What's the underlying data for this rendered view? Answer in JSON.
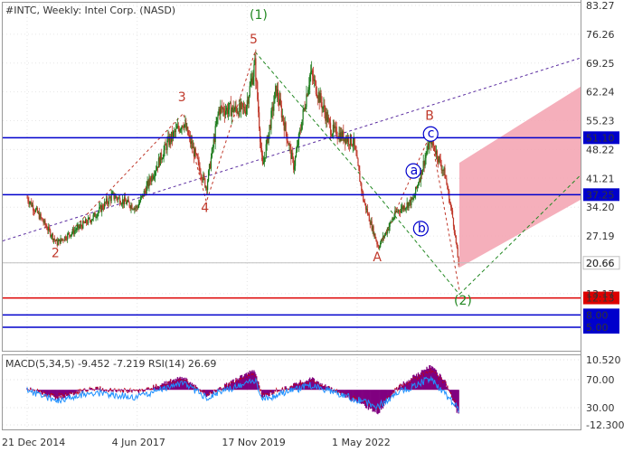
{
  "chart_data": [
    {
      "type": "candlestick",
      "title": "#INTC, Weekly:  Intel Corp. (NASD)",
      "y_ticks": [
        83.27,
        76.26,
        69.25,
        62.24,
        55.23,
        48.22,
        41.21,
        34.2,
        27.19,
        20.66,
        13.17,
        12.13,
        8.0,
        5.0
      ],
      "y_tick_labels": [
        "83.27",
        "76.26",
        "69.25",
        "62.24",
        "55.23",
        "48.22",
        "41.21",
        "34.20",
        "27.19",
        "20.66",
        "13.17"
      ],
      "x_tick_labels": [
        "21 Dec 2014",
        "4 Jun 2017",
        "17 Nov 2019",
        "1 May 2022"
      ],
      "price_path": [
        {
          "x": "2014-12-21",
          "y": 36.5
        },
        {
          "x": "2015-04-01",
          "y": 32.0
        },
        {
          "x": "2015-08-20",
          "y": 25.5
        },
        {
          "x": "2016-06-01",
          "y": 31.5
        },
        {
          "x": "2016-11-15",
          "y": 37.0
        },
        {
          "x": "2017-06-01",
          "y": 34.0
        },
        {
          "x": "2018-02-10",
          "y": 50.0
        },
        {
          "x": "2018-06-15",
          "y": 55.0
        },
        {
          "x": "2018-12-20",
          "y": 39.0
        },
        {
          "x": "2019-04-01",
          "y": 58.0
        },
        {
          "x": "2019-11-01",
          "y": 58.0
        },
        {
          "x": "2020-01-20",
          "y": 69.0
        },
        {
          "x": "2020-03-20",
          "y": 43.5
        },
        {
          "x": "2020-07-10",
          "y": 63.0
        },
        {
          "x": "2020-12-01",
          "y": 44.0
        },
        {
          "x": "2021-04-15",
          "y": 67.0
        },
        {
          "x": "2021-10-01",
          "y": 53.0
        },
        {
          "x": "2022-04-01",
          "y": 50.0
        },
        {
          "x": "2022-06-20",
          "y": 36.0
        },
        {
          "x": "2022-10-20",
          "y": 24.5
        },
        {
          "x": "2023-03-15",
          "y": 33.0
        },
        {
          "x": "2023-08-01",
          "y": 36.0
        },
        {
          "x": "2023-12-20",
          "y": 51.0
        },
        {
          "x": "2024-04-15",
          "y": 42.0
        },
        {
          "x": "2024-06-20",
          "y": 31.0
        },
        {
          "x": "2024-08-10",
          "y": 19.0
        }
      ],
      "horizontal_levels": [
        {
          "value": 51.1,
          "label": "51.10",
          "color": "#0000cc"
        },
        {
          "value": 37.25,
          "label": "37.25",
          "color": "#0000cc"
        },
        {
          "value": 20.66,
          "label": "20.66",
          "color": "#c0c0c0"
        },
        {
          "value": 12.13,
          "label": "12.13",
          "color": "#dd0000"
        },
        {
          "value": 8.0,
          "label": "8.00",
          "color": "#0000cc"
        },
        {
          "value": 5.0,
          "label": "5.00",
          "color": "#0000cc"
        }
      ],
      "wave_labels": [
        {
          "text": "(1)",
          "x": "2020-01-20",
          "y": 80.0,
          "color": "#228822"
        },
        {
          "text": "5",
          "x": "2020-01-20",
          "y": 74.0,
          "color": "#c0392b"
        },
        {
          "text": "3",
          "x": "2018-06-15",
          "y": 60.0,
          "color": "#c0392b"
        },
        {
          "text": "4",
          "x": "2018-12-20",
          "y": 33.0,
          "color": "#c0392b"
        },
        {
          "text": "2",
          "x": "2015-08-20",
          "y": 22.0,
          "color": "#c0392b"
        },
        {
          "text": "A",
          "x": "2022-10-20",
          "y": 21.0,
          "color": "#c0392b"
        },
        {
          "text": "B",
          "x": "2023-12-20",
          "y": 55.5,
          "color": "#c0392b"
        },
        {
          "text": "(2)",
          "x": "2024-08-10",
          "y": 10.5,
          "color": "#228822"
        }
      ],
      "circled_labels": [
        {
          "text": "a",
          "x": "2023-08-01",
          "y": 43.0
        },
        {
          "text": "b",
          "x": "2023-10-01",
          "y": 29.0
        },
        {
          "text": "c",
          "x": "2023-12-20",
          "y": 52.0
        }
      ],
      "forecast_channel_color": "#f4a6b4",
      "colors": {
        "bull": "#1a7a1a",
        "bear": "#c0392b",
        "level_blue": "#0000cc",
        "level_red": "#dd0000",
        "label_bg": "#0000cc"
      }
    },
    {
      "type": "histogram",
      "title": "MACD(5,34,5) -9.452 -7.219 RSI(14) 26.69",
      "y_tick_labels": [
        "10.520",
        "70.00",
        "30.00",
        "-12.300"
      ],
      "macd_path": [
        {
          "x": "2014-12-21",
          "y": 0.5
        },
        {
          "x": "2015-08-20",
          "y": -3.0
        },
        {
          "x": "2016-06-01",
          "y": 0.5
        },
        {
          "x": "2017-06-01",
          "y": -0.8
        },
        {
          "x": "2018-06-15",
          "y": 4.5
        },
        {
          "x": "2018-12-20",
          "y": -2.0
        },
        {
          "x": "2020-01-20",
          "y": 7.0
        },
        {
          "x": "2020-03-20",
          "y": -2.5
        },
        {
          "x": "2021-04-15",
          "y": 4.0
        },
        {
          "x": "2022-10-20",
          "y": -8.0
        },
        {
          "x": "2023-03-15",
          "y": 0.5
        },
        {
          "x": "2023-12-20",
          "y": 8.5
        },
        {
          "x": "2024-04-15",
          "y": 3.0
        },
        {
          "x": "2024-08-10",
          "y": -9.452
        }
      ],
      "rsi_path": [
        {
          "x": "2014-12-21",
          "y": 55
        },
        {
          "x": "2015-08-20",
          "y": 40
        },
        {
          "x": "2016-06-01",
          "y": 52
        },
        {
          "x": "2017-06-01",
          "y": 45
        },
        {
          "x": "2018-06-15",
          "y": 65
        },
        {
          "x": "2018-12-20",
          "y": 45
        },
        {
          "x": "2020-01-20",
          "y": 70
        },
        {
          "x": "2020-03-20",
          "y": 42
        },
        {
          "x": "2021-04-15",
          "y": 62
        },
        {
          "x": "2022-10-20",
          "y": 32
        },
        {
          "x": "2023-03-15",
          "y": 50
        },
        {
          "x": "2023-12-20",
          "y": 72
        },
        {
          "x": "2024-04-15",
          "y": 50
        },
        {
          "x": "2024-08-10",
          "y": 26.69
        }
      ],
      "colors": {
        "hist": "#800080",
        "rsi": "#1e90ff",
        "signal": "#cc0000"
      }
    }
  ]
}
